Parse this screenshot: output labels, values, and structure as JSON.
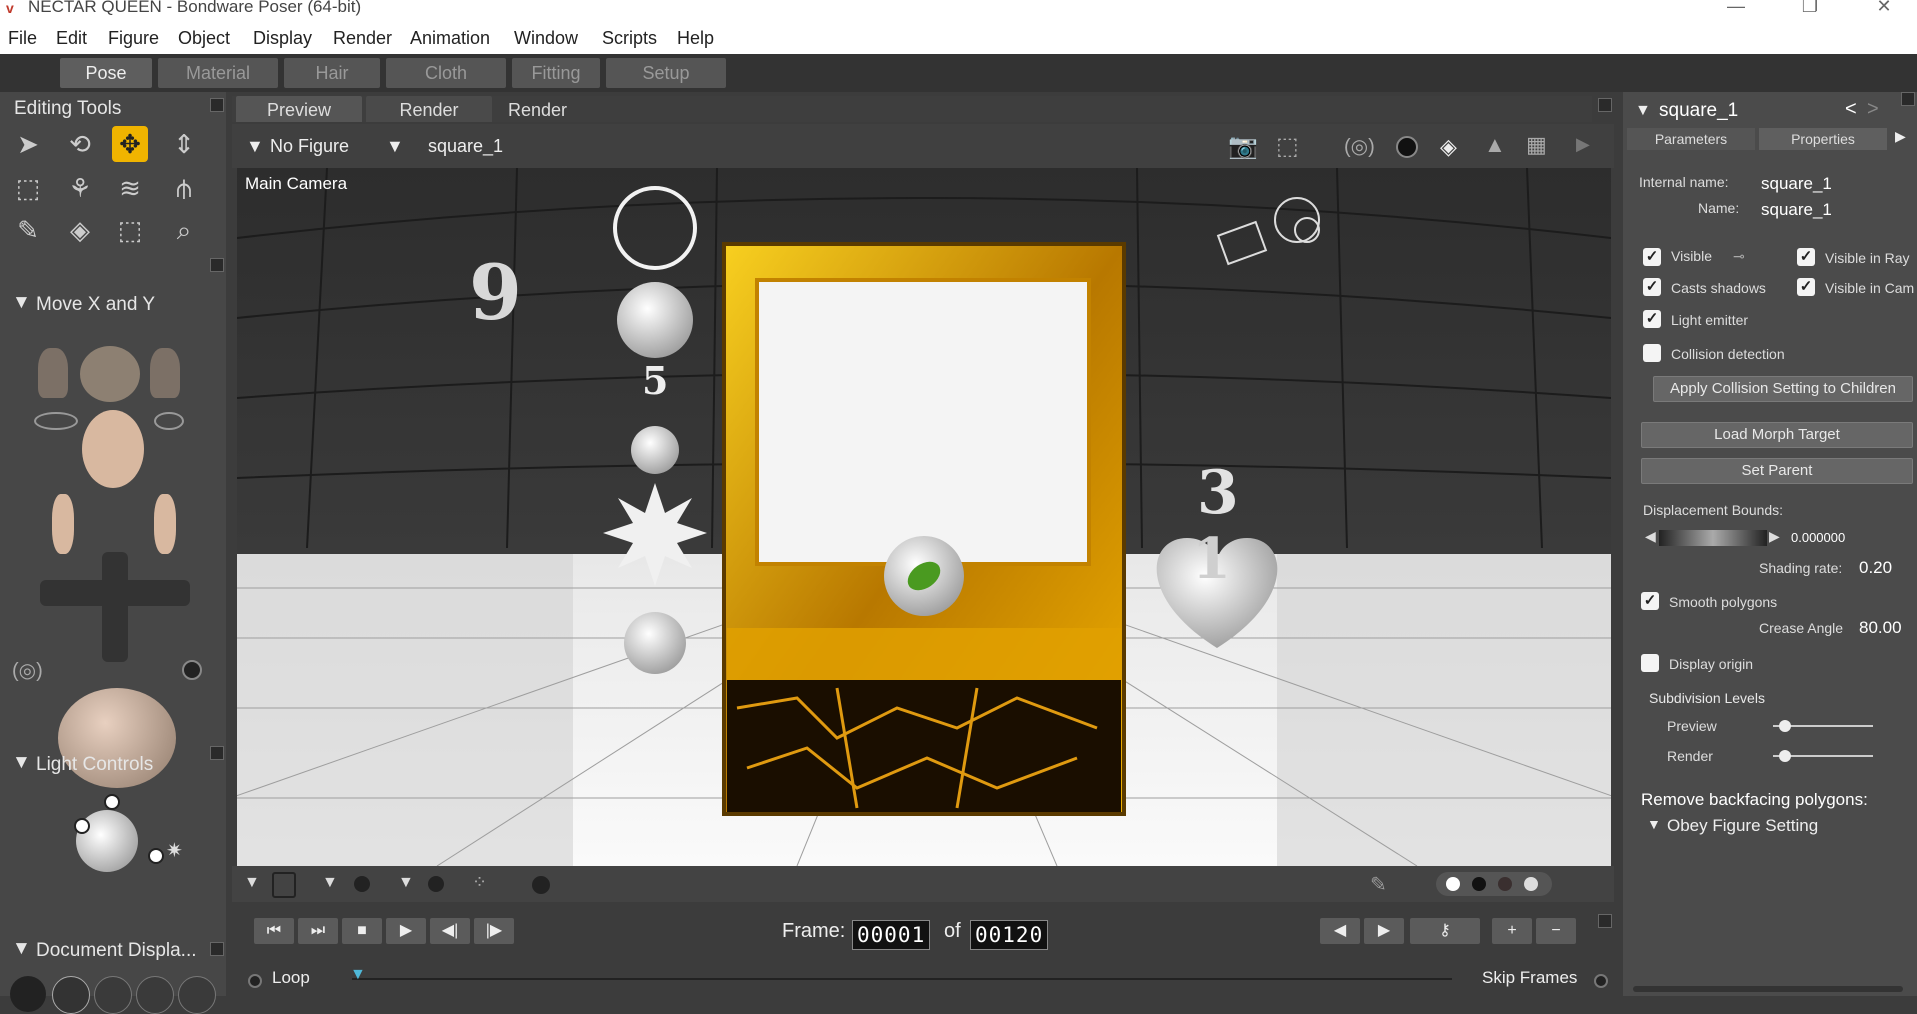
{
  "window": {
    "title": "NECTAR QUEEN - Bondware Poser (64-bit)"
  },
  "menu": [
    "File",
    "Edit",
    "Figure",
    "Object",
    "Display",
    "Render",
    "Animation",
    "Window",
    "Scripts",
    "Help"
  ],
  "room_tabs": [
    "Pose",
    "Material",
    "Hair",
    "Cloth",
    "Fitting",
    "Setup"
  ],
  "left": {
    "editing_tools": "Editing Tools",
    "move_title": "Move X and Y",
    "light_controls": "Light Controls",
    "document_display": "Document Displa..."
  },
  "viewport": {
    "tabs": [
      "Preview",
      "Render",
      "Render"
    ],
    "figure_select": "No Figure",
    "actor_select": "square_1",
    "camera_label": "Main Camera",
    "scene_labels": [
      "9",
      "5",
      "3",
      "1"
    ]
  },
  "animation": {
    "frame_label": "Frame:",
    "current_frame": "00001",
    "of_label": "of",
    "total_frames": "00120",
    "loop": "Loop",
    "skip_frames": "Skip Frames"
  },
  "right": {
    "actor": "square_1",
    "tabs": [
      "Parameters",
      "Properties"
    ],
    "internal_name_label": "Internal name:",
    "internal_name": "square_1",
    "name_label": "Name:",
    "name": "square_1",
    "visible": "Visible",
    "visible_in_ray": "Visible in Ray",
    "casts_shadows": "Casts shadows",
    "visible_in_cam": "Visible in Cam",
    "light_emitter": "Light emitter",
    "collision_detection": "Collision detection",
    "apply_collision": "Apply Collision Setting to Children",
    "load_morph": "Load Morph Target",
    "set_parent": "Set Parent",
    "displacement_bounds_label": "Displacement Bounds:",
    "displacement_bounds": "0.000000",
    "shading_rate_label": "Shading rate:",
    "shading_rate": "0.20",
    "smooth_polygons": "Smooth polygons",
    "crease_angle_label": "Crease Angle",
    "crease_angle": "80.00",
    "display_origin": "Display origin",
    "subdivision_levels": "Subdivision Levels",
    "preview": "Preview",
    "render": "Render",
    "remove_backfacing": "Remove backfacing polygons:",
    "obey_figure": "Obey Figure Setting"
  },
  "colors": {
    "accent": "#f0b400",
    "panel": "#474747",
    "frame_gold": "#d89a10"
  }
}
